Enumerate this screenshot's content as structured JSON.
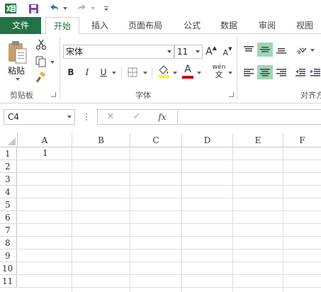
{
  "quick_access": {
    "excel_icon": "excel-logo-icon",
    "save_icon": "save-icon",
    "undo_icon": "undo-icon",
    "redo_icon": "redo-icon",
    "customize_icon": "customize-qat-icon"
  },
  "tabs": [
    {
      "label": "文件"
    },
    {
      "label": "开始"
    },
    {
      "label": "插入"
    },
    {
      "label": "页面布局"
    },
    {
      "label": "公式"
    },
    {
      "label": "数据"
    },
    {
      "label": "审阅"
    },
    {
      "label": "视图"
    }
  ],
  "ribbon": {
    "clipboard": {
      "paste_label": "粘贴",
      "group_label": "剪贴板"
    },
    "font": {
      "font_name": "宋体",
      "font_size": "11",
      "bold": "B",
      "italic": "I",
      "underline": "U",
      "phonetic": "wén",
      "increase": "A",
      "decrease": "A",
      "color_letter": "A",
      "group_label": "字体"
    },
    "alignment": {
      "group_label": "对齐方"
    },
    "colors": {
      "excel_green": "#217346",
      "fill_yellow": "#ffff00",
      "font_red": "#c00000",
      "align_selected": "#9fd5b7"
    }
  },
  "formula_bar": {
    "name_box": "C4",
    "cancel_icon": "✕",
    "enter_icon": "✓",
    "fx": "fx",
    "value": ""
  },
  "sheet": {
    "columns": [
      "A",
      "B",
      "C",
      "D",
      "E",
      "F"
    ],
    "rows": [
      "1",
      "2",
      "3",
      "4",
      "5",
      "6",
      "7",
      "8",
      "9",
      "10",
      "11"
    ],
    "cells": {
      "A1": "1"
    }
  }
}
